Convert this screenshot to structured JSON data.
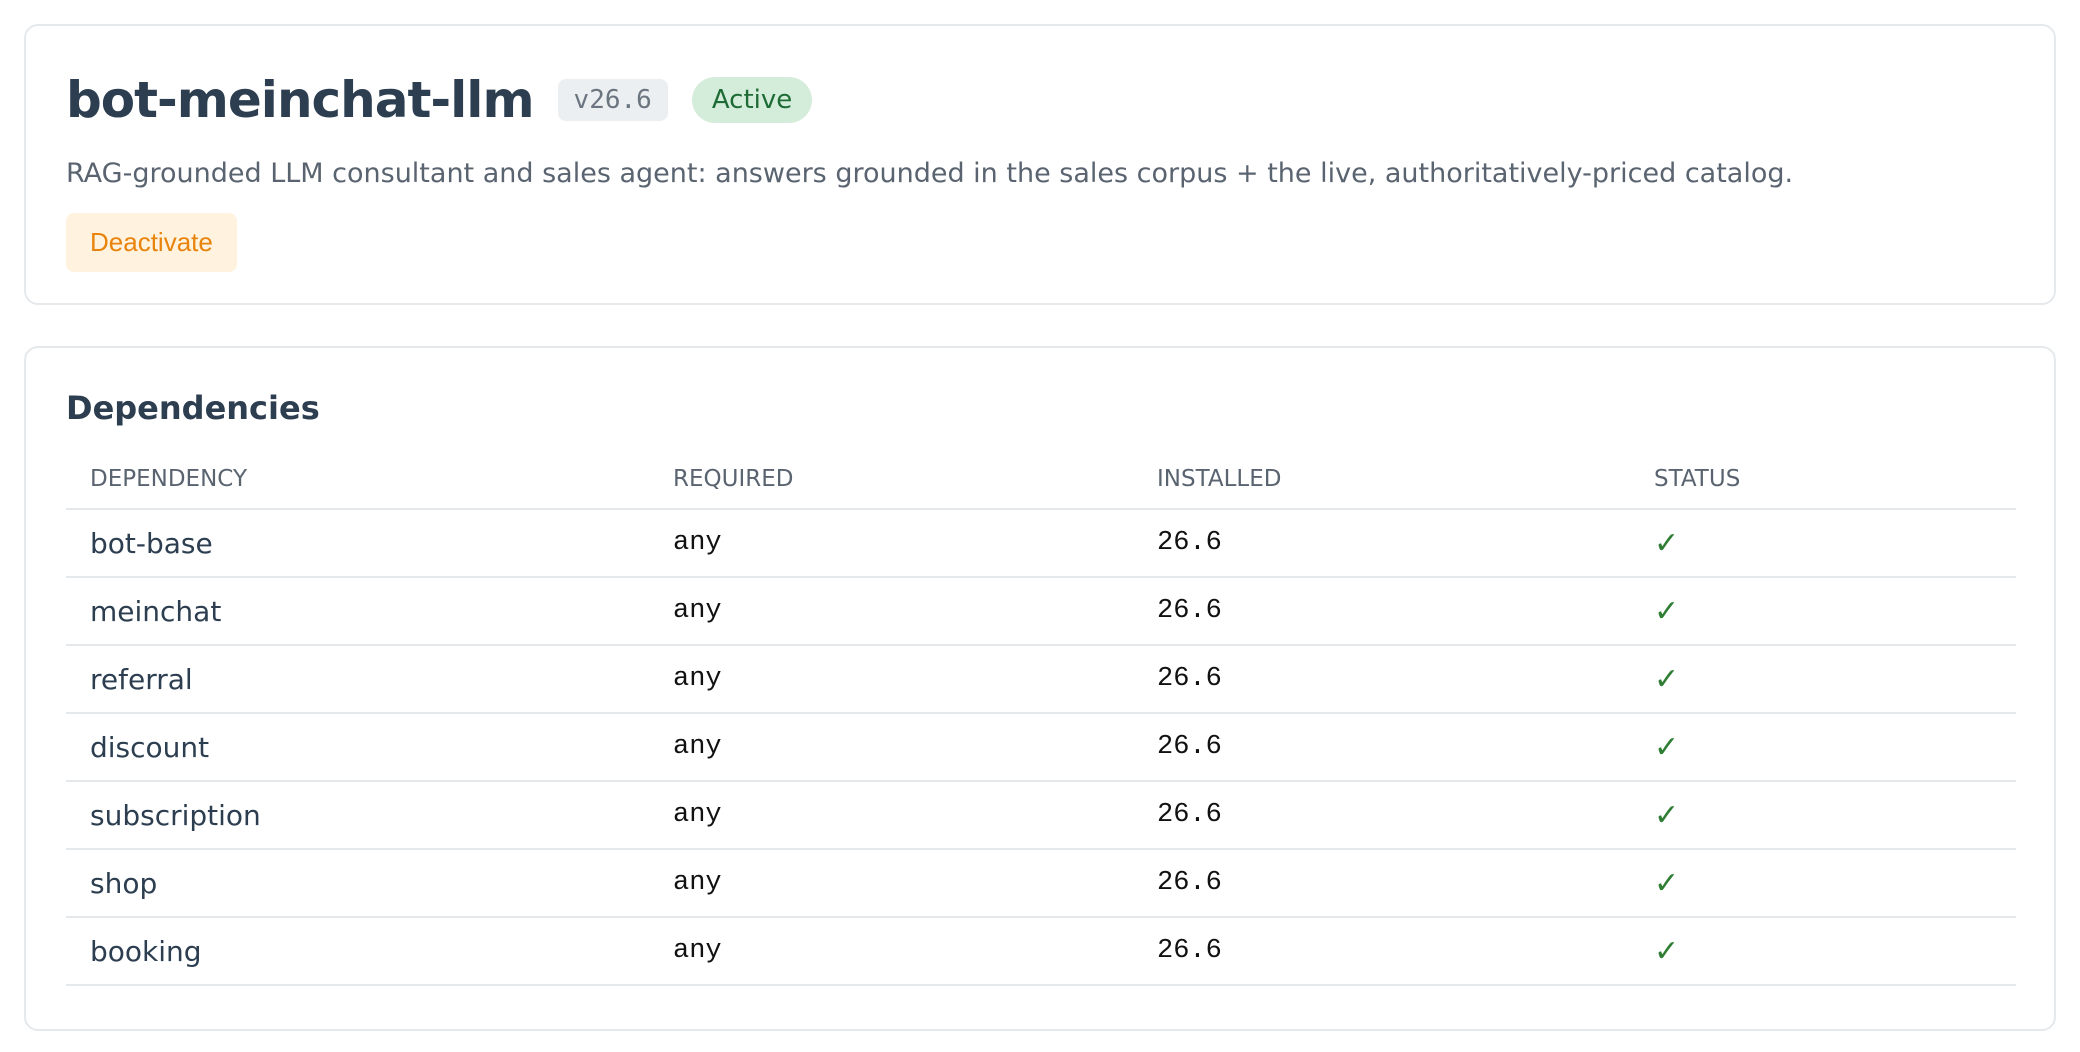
{
  "module": {
    "title": "bot-meinchat-llm",
    "version": "v26.6",
    "status": "Active",
    "description": "RAG-grounded LLM consultant and sales agent: answers grounded in the sales corpus + the live, authoritatively-priced catalog.",
    "deactivate_label": "Deactivate"
  },
  "dependencies": {
    "title": "Dependencies",
    "columns": [
      "DEPENDENCY",
      "REQUIRED",
      "INSTALLED",
      "STATUS"
    ],
    "rows": [
      {
        "name": "bot-base",
        "required": "any",
        "installed": "26.6",
        "status": "✓"
      },
      {
        "name": "meinchat",
        "required": "any",
        "installed": "26.6",
        "status": "✓"
      },
      {
        "name": "referral",
        "required": "any",
        "installed": "26.6",
        "status": "✓"
      },
      {
        "name": "discount",
        "required": "any",
        "installed": "26.6",
        "status": "✓"
      },
      {
        "name": "subscription",
        "required": "any",
        "installed": "26.6",
        "status": "✓"
      },
      {
        "name": "shop",
        "required": "any",
        "installed": "26.6",
        "status": "✓"
      },
      {
        "name": "booking",
        "required": "any",
        "installed": "26.6",
        "status": "✓"
      }
    ]
  },
  "colors": {
    "accent_active": "#1f6b36",
    "warning": "#e8830c",
    "ok_check": "#2e7d32"
  },
  "icons": {
    "status_ok": "checkmark-icon"
  }
}
